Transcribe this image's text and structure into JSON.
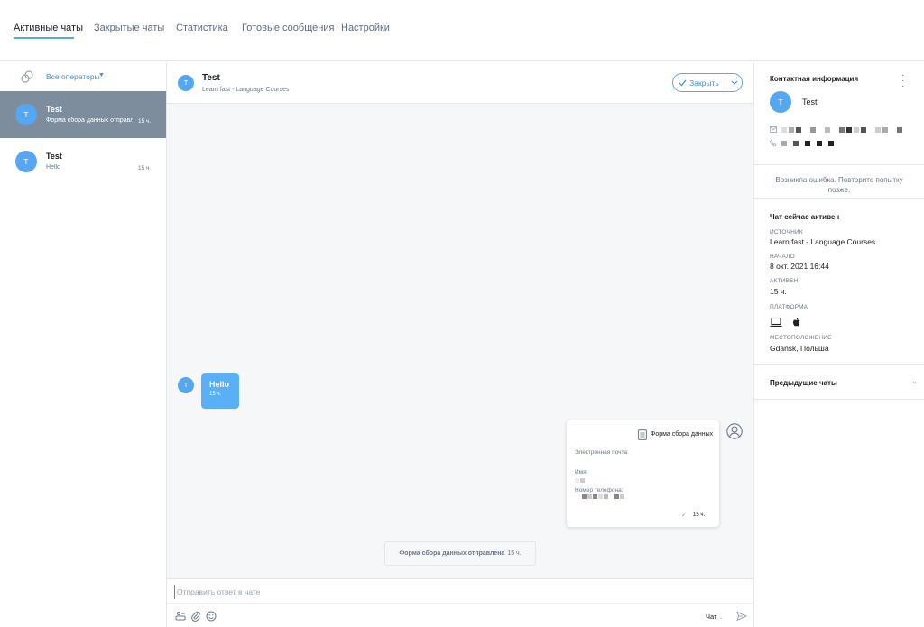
{
  "nav": {
    "tabs": [
      {
        "label": "Активные чаты"
      },
      {
        "label": "Закрытые чаты"
      },
      {
        "label": "Статистика"
      },
      {
        "label": "Готовые сообщения"
      },
      {
        "label": "Настройки"
      }
    ]
  },
  "sidebar": {
    "operators_filter": "Все операторы",
    "conversations": [
      {
        "avatar": "T",
        "name": "Test",
        "preview": "Форма сбора данных отправлена",
        "time": "15 ч."
      },
      {
        "avatar": "T",
        "name": "Test",
        "preview": "Hello",
        "time": "15 ч."
      }
    ]
  },
  "chat": {
    "avatar": "T",
    "title": "Test",
    "subtitle": "Learn fast - Language Courses",
    "close_label": "Закрыть",
    "message": {
      "avatar": "T",
      "text": "Hello",
      "time": "15 ч."
    },
    "form_card": {
      "title": "Форма сбора данных",
      "email_label": "Электронная почта:",
      "name_label": "Имя:",
      "phone_label": "Номер телефона:",
      "time": "15 ч."
    },
    "system_note": {
      "text": "Форма сбора данных отправлена",
      "time": "15 ч."
    },
    "composer": {
      "placeholder": "Отправить ответ в чате",
      "channel": "Чат"
    }
  },
  "contact": {
    "heading": "Контактная информация",
    "avatar": "T",
    "name": "Test",
    "error": "Возникла ошибка. Повторите попытку позже.",
    "chat_status": {
      "heading": "Чат сейчас активен",
      "source_label": "ИСТОЧНИК",
      "source": "Learn fast - Language Courses",
      "start_label": "НАЧАЛО",
      "start": "8 окт. 2021 16:44",
      "active_label": "АКТИВЕН",
      "active": "15 ч.",
      "platform_label": "ПЛАТФОРМА",
      "location_label": "МЕСТОПОЛОЖЕНИЕ",
      "location": "Gdansk, Польша"
    },
    "previous_chats": "Предыдущие чаты"
  },
  "colors": {
    "accent": "#56a6f0",
    "selected_row": "#7e8d9e",
    "bubble": "#5ab0f7"
  },
  "icons": [
    "operators-icon",
    "check-icon",
    "chevron-down-icon",
    "document-icon",
    "user-circle-icon",
    "email-icon",
    "phone-icon",
    "laptop-icon",
    "apple-icon",
    "kebab-icon",
    "attachment-icon",
    "paperclip-icon",
    "emoji-icon",
    "send-icon"
  ]
}
